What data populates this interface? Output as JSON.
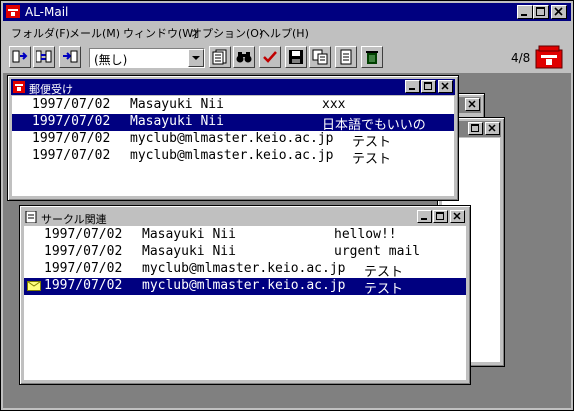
{
  "app": {
    "title": "AL-Mail"
  },
  "menu": [
    {
      "label": "フォルダ(F)"
    },
    {
      "label": "メール(M)"
    },
    {
      "label": "ウィンドウ(W)"
    },
    {
      "label": "オプション(O)"
    },
    {
      "label": "ヘルプ(H)"
    }
  ],
  "toolbar": {
    "folder_select_value": "(無し)",
    "message_counter": "4/8"
  },
  "windows": {
    "inbox": {
      "title": "郵便受け",
      "rows": [
        {
          "date": "1997/07/02",
          "from": "Masayuki Nii",
          "subject": "xxx",
          "selected": false
        },
        {
          "date": "1997/07/02",
          "from": "Masayuki Nii",
          "subject": "日本語でもいいの",
          "selected": true
        },
        {
          "date": "1997/07/02",
          "from": "myclub@mlmaster.keio.ac.jp",
          "subject": "テスト",
          "selected": false
        },
        {
          "date": "1997/07/02",
          "from": "myclub@mlmaster.keio.ac.jp",
          "subject": "テスト",
          "selected": false
        }
      ]
    },
    "circle": {
      "title": "サークル関連",
      "rows": [
        {
          "date": "1997/07/02",
          "from": "Masayuki Nii",
          "subject": "hellow!!",
          "selected": false
        },
        {
          "date": "1997/07/02",
          "from": "Masayuki Nii",
          "subject": "urgent mail",
          "selected": false
        },
        {
          "date": "1997/07/02",
          "from": "myclub@mlmaster.keio.ac.jp",
          "subject": "テスト",
          "selected": false
        },
        {
          "date": "1997/07/02",
          "from": "myclub@mlmaster.keio.ac.jp",
          "subject": "テスト",
          "selected": true
        }
      ]
    }
  }
}
